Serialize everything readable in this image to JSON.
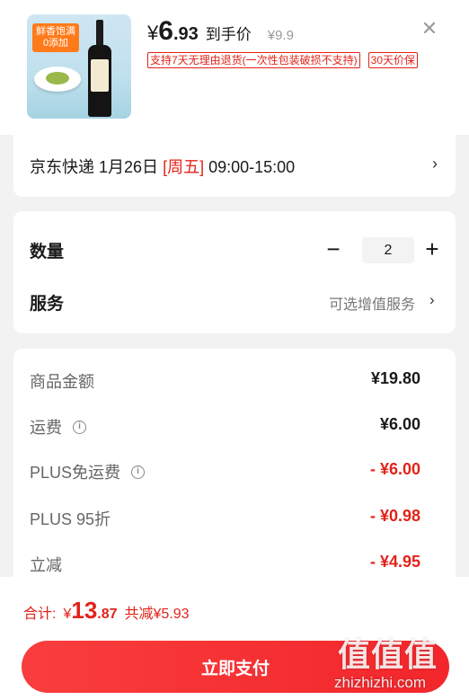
{
  "header": {
    "price_symbol": "¥",
    "price_int": "6",
    "price_dec": ".93",
    "price_label": "到手价",
    "original_price": "¥9.9",
    "badges": [
      "支持7天无理由退货(一次性包装破损不支持)",
      "30天价保"
    ],
    "close_icon": "close-icon",
    "product_image_tag": "鲜香饱满 0添加"
  },
  "delivery": {
    "carrier": "京东快递",
    "date": "1月26日",
    "weekday": "[周五]",
    "time_range": "09:00-15:00",
    "chevron_icon": "chevron-right-icon"
  },
  "order": {
    "quantity_label": "数量",
    "quantity_value": "2",
    "minus_label": "−",
    "plus_label": "+",
    "service_label": "服务",
    "service_value": "可选增值服务"
  },
  "costs": [
    {
      "label": "商品金额",
      "value": "¥19.80",
      "info": false,
      "red": false
    },
    {
      "label": "运费",
      "value": "¥6.00",
      "info": true,
      "red": false
    },
    {
      "label": "PLUS免运费",
      "value": "- ¥6.00",
      "info": true,
      "red": true
    },
    {
      "label": "PLUS 95折",
      "value": "- ¥0.98",
      "info": false,
      "red": true
    },
    {
      "label": "立减",
      "value": "- ¥4.95",
      "info": false,
      "red": true
    }
  ],
  "footer": {
    "total_label": "合计:",
    "total_symbol": "¥",
    "total_int": "13",
    "total_dec": ".87",
    "saving": "共减¥5.93",
    "pay_button": "立即支付"
  },
  "watermark": {
    "logo": "值值值",
    "url": "zhizhizhi.com"
  },
  "colors": {
    "accent_red": "#e2231a",
    "pay_button": "#f2262b",
    "background": "#f2f2f2"
  }
}
